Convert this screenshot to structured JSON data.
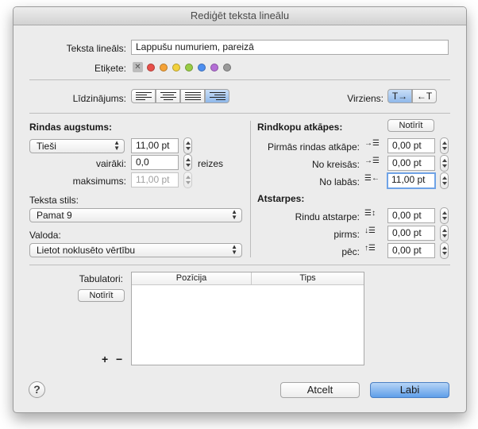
{
  "window": {
    "title": "Rediģēt teksta lineālu"
  },
  "ruler": {
    "name_label": "Teksta lineāls:",
    "name_value": "Lappušu numuriem, pareizā",
    "tag_label": "Etiķete:",
    "tag_none_glyph": "✕",
    "tag_colors": [
      "#e8504a",
      "#f5a236",
      "#f2d13c",
      "#98cc45",
      "#4e8ff0",
      "#b46fd6",
      "#9a9a9a"
    ]
  },
  "alignment": {
    "label": "Līdzinājums:",
    "options": [
      "align-left",
      "align-center",
      "align-justify",
      "align-right"
    ],
    "selected": "align-right"
  },
  "direction": {
    "label": "Virziens:",
    "ltr": "T→",
    "rtl": "←T",
    "selected": "ltr"
  },
  "line_height": {
    "heading": "Rindas augstums:",
    "mode": "Tieši",
    "value": "11,00 pt",
    "multiple_label": "vairāki:",
    "multiple_value": "0,0",
    "multiple_unit": "reizes",
    "max_label": "maksimums:",
    "max_value": "11,00 pt"
  },
  "text_style": {
    "label": "Teksta stils:",
    "value": "Pamat 9"
  },
  "language": {
    "label": "Valoda:",
    "value": "Lietot noklusēto vērtību"
  },
  "indents": {
    "heading": "Rindkopu atkāpes:",
    "reset": "Notīrīt",
    "first_line_label": "Pirmās rindas atkāpe:",
    "first_line_value": "0,00 pt",
    "left_label": "No kreisās:",
    "left_value": "0,00 pt",
    "right_label": "No labās:",
    "right_value": "11,00 pt"
  },
  "spacing": {
    "heading": "Atstarpes:",
    "line_label": "Rindu atstarpe:",
    "line_value": "0,00 pt",
    "before_label": "pirms:",
    "before_value": "0,00 pt",
    "after_label": "pēc:",
    "after_value": "0,00 pt"
  },
  "tabs": {
    "label": "Tabulatori:",
    "reset": "Notīrīt",
    "columns": [
      "Pozīcija",
      "Tips"
    ],
    "rows": [],
    "add": "+",
    "remove": "−"
  },
  "footer": {
    "help": "?",
    "cancel": "Atcelt",
    "ok": "Labi"
  },
  "accent_color": "#5f9ee9"
}
